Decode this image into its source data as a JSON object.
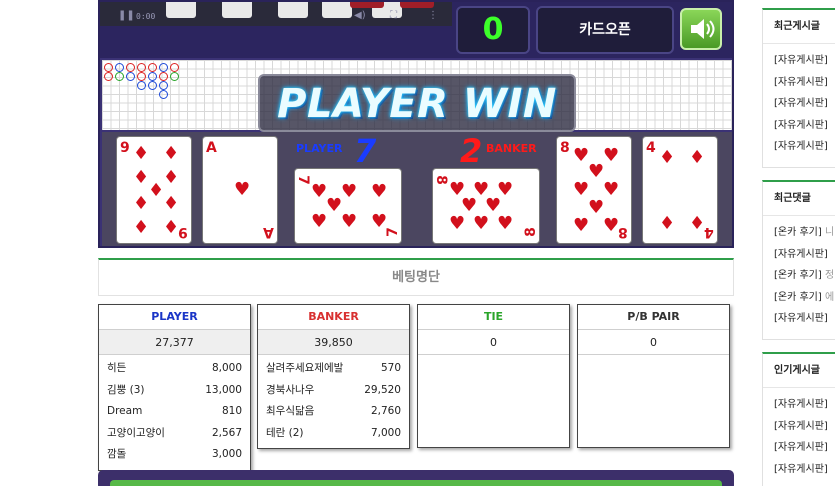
{
  "game": {
    "video_time": "0:00",
    "counter": "0",
    "card_open_label": "카드오픈",
    "result_banner": "PLAYER WIN",
    "player": {
      "label": "PLAYER",
      "score": "7"
    },
    "banker": {
      "label": "BANKER",
      "score": "2"
    },
    "player_cards": [
      "9",
      "A",
      "7"
    ],
    "banker_cards": [
      "8",
      "8",
      "4"
    ]
  },
  "betting": {
    "title": "베팅명단",
    "panels": [
      {
        "name": "PLAYER",
        "color": "#1a35c7",
        "total": "27,377",
        "rows": [
          {
            "user": "히든",
            "amount": "8,000"
          },
          {
            "user": "김뿡 (3)",
            "amount": "13,000"
          },
          {
            "user": "Dream",
            "amount": "810"
          },
          {
            "user": "고양이고양이",
            "amount": "2,567"
          },
          {
            "user": "깜돌",
            "amount": "3,000"
          }
        ]
      },
      {
        "name": "BANKER",
        "color": "#d83030",
        "total": "39,850",
        "rows": [
          {
            "user": "살려주세요제에발",
            "amount": "570"
          },
          {
            "user": "경북사나우",
            "amount": "29,520"
          },
          {
            "user": "최우식닮음",
            "amount": "2,760"
          },
          {
            "user": "테란 (2)",
            "amount": "7,000"
          }
        ]
      },
      {
        "name": "TIE",
        "color": "#2aa52a",
        "total": "0",
        "rows": []
      },
      {
        "name": "P/B PAIR",
        "color": "#333333",
        "total": "0",
        "rows": []
      }
    ]
  },
  "sidebar": {
    "recent_posts": {
      "title": "최근게시글",
      "items": [
        "[자유게시판]",
        "[자유게시판]",
        "[자유게시판]",
        "[자유게시판]",
        "[자유게시판]"
      ]
    },
    "recent_comments": {
      "title": "최근댓글",
      "items": [
        {
          "tag": "[온카 후기]",
          "rest": " 니"
        },
        {
          "tag": "[자유게시판]",
          "rest": ""
        },
        {
          "tag": "[온카 후기]",
          "rest": " 정"
        },
        {
          "tag": "[온카 후기]",
          "rest": " 에"
        },
        {
          "tag": "[자유게시판]",
          "rest": ""
        }
      ]
    },
    "popular_posts": {
      "title": "인기게시글",
      "items": [
        "[자유게시판]",
        "[자유게시판]",
        "[자유게시판]",
        "[자유게시판]"
      ]
    }
  },
  "colors": {
    "accent_green": "#2f9e4a",
    "game_bg": "#3b3275",
    "counter_green": "#3cff2a"
  },
  "icons": [
    "play-icon",
    "volume-icon",
    "fullscreen-icon",
    "menu-dots-icon",
    "speaker-icon",
    "heart-icon",
    "diamond-icon"
  ]
}
